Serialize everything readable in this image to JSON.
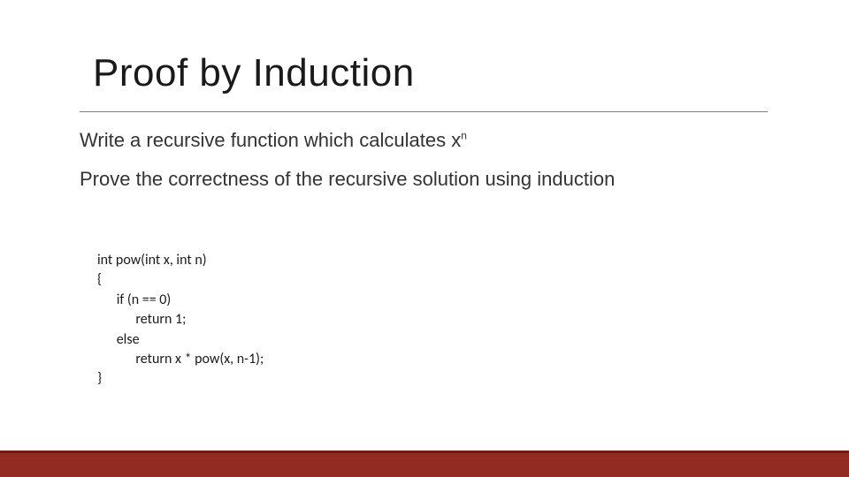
{
  "slide": {
    "title": "Proof by Induction",
    "line1_prefix": "Write a recursive function which calculates x",
    "line1_sup": "n",
    "line2": "Prove the correctness of the  recursive solution using induction",
    "code": "int pow(int x, int n)\n{\n      if (n == 0)\n            return 1;\n      else\n            return x * pow(x, n-1);\n}"
  },
  "colors": {
    "accent": "#922b21",
    "accent_dark": "#6e2015",
    "text": "#1a1a1a"
  }
}
